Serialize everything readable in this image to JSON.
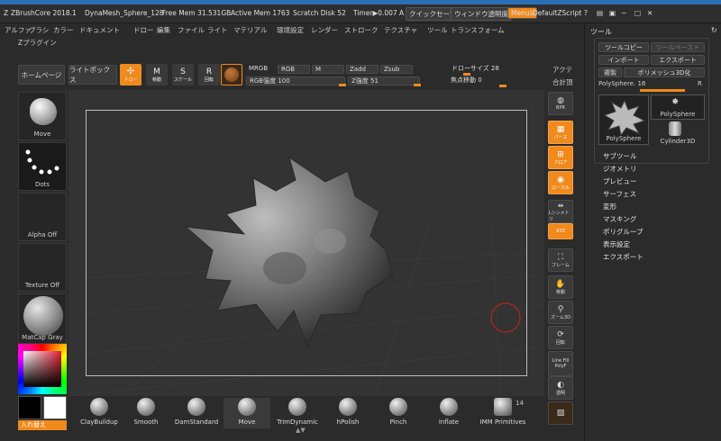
{
  "titlebar": {
    "app": "ZBrushCore 2018.1",
    "doc": "DynaMesh_Sphere_128",
    "free_mem": "Free Mem 31.531GB",
    "active_mem": "Active Mem 1763",
    "scratch": "Scratch Disk 52",
    "timer": "Timer▶0.007 A",
    "quicksave": "クイックセーブ",
    "transparency": "ウィンドウ透明度",
    "menus": "Menus",
    "script": "DefaultZScript"
  },
  "menubar": [
    "アルファ",
    "ブラシ",
    "カラー",
    "ドキュメント",
    "ドロー",
    "編集",
    "ファイル",
    "ライト",
    "マテリアル",
    "環境設定",
    "レンダー",
    "ストローク",
    "テクスチャ",
    "ツール",
    "トランスフォーム"
  ],
  "zplugin": "Zプラグイン",
  "toolbar": {
    "home": "ホームページ",
    "lightbox": "ライトボックス",
    "draw_label": "ドロー",
    "move_label": "移動",
    "scale_label": "スケール",
    "rotate_label": "回転",
    "mrgb": "MRGB",
    "rgb": "RGB",
    "m": "M",
    "zadd": "Zadd",
    "zsub": "Zsub",
    "rgb_strength": "RGB強度 100",
    "z_strength": "Z強度 51",
    "draw_size": "ドローサイズ 28",
    "focal": "焦点移動 0",
    "activate": "アクテ",
    "total": "合計頂"
  },
  "left": {
    "move": "Move",
    "dots": "Dots",
    "alpha_off": "Alpha Off",
    "texture_off": "Texture Off",
    "matcap": "MatCap Gray",
    "swap": "入れ替え"
  },
  "right_icons": [
    {
      "label": "BPR"
    },
    {
      "label": "パース"
    },
    {
      "label": "フロア"
    },
    {
      "label": "ローカル"
    },
    {
      "label": "Lシンメトリ"
    },
    {
      "label": "XYZ"
    },
    {
      "label": "フレーム"
    },
    {
      "label": "移動"
    },
    {
      "label": "ズーム3D"
    },
    {
      "label": "回転"
    },
    {
      "label": "Line Fill PolyF"
    },
    {
      "label": "透明"
    }
  ],
  "tool_panel": {
    "title": "ツール",
    "copy": "ツールコピー",
    "paste": "ツールペースト",
    "import": "インポート",
    "export": "エクスポート",
    "clone": "複製",
    "polymesh": "ポリメッシュ3D化",
    "polysphere": "PolySphere. 16",
    "r": "R",
    "thumb1": "PolySphere",
    "thumb2": "PolySphere",
    "thumb3": "Cylinder3D",
    "menu": [
      "サブツール",
      "ジオメトリ",
      "プレビュー",
      "サーフェス",
      "変形",
      "マスキング",
      "ポリグループ",
      "表示設定",
      "エクスポート"
    ]
  },
  "brushes": [
    "ClayBuildup",
    "Smooth",
    "DamStandard",
    "Move",
    "TrimDynamic",
    "hPolish",
    "Pinch",
    "Inflate",
    "IMM Primitives"
  ],
  "brush_count": "14",
  "colors": {
    "accent": "#f08a1c",
    "bg": "#2b2b2b",
    "viewport": "#333333"
  }
}
